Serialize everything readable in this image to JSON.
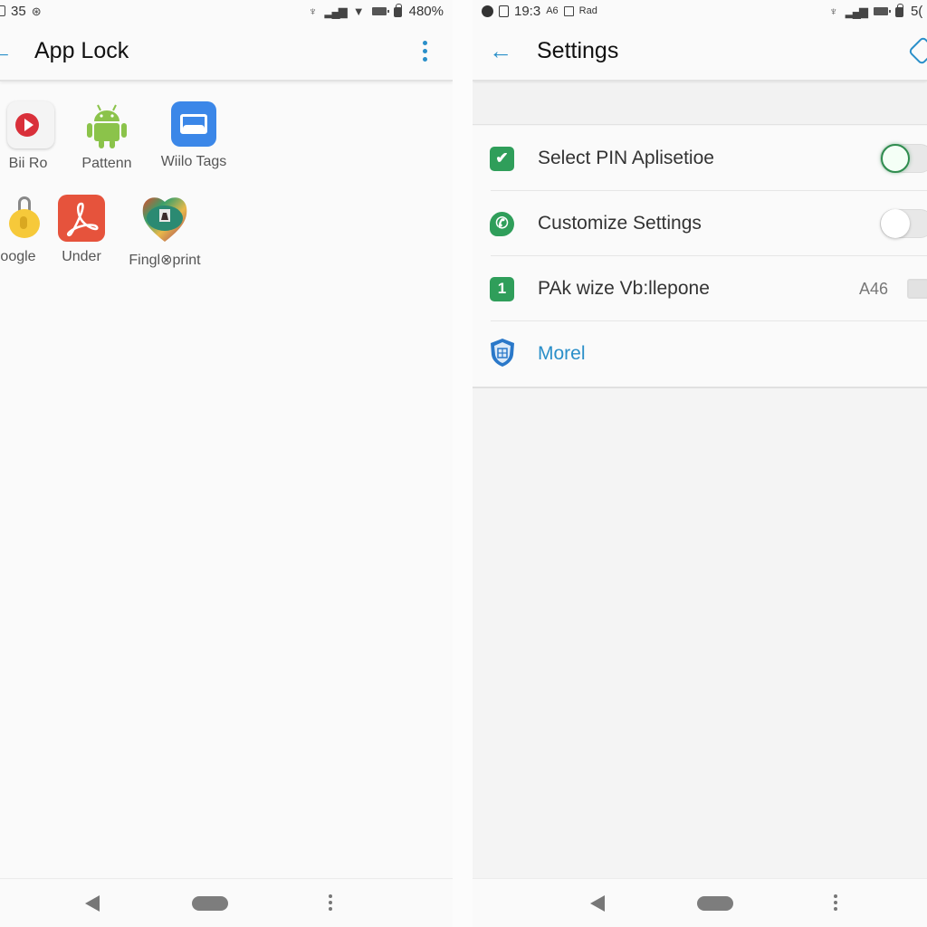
{
  "left_screen": {
    "status_bar": {
      "left_text": "35",
      "right_text": "480%",
      "icons_left": [
        "notification-icon",
        "cast-icon"
      ],
      "icons_right": [
        "hotspot-icon",
        "signal-icon",
        "wifi-icon",
        "battery-icon",
        "lock-icon"
      ]
    },
    "app_bar": {
      "title": "App Lock",
      "back_icon": "←",
      "menu_icon": "overflow-menu-icon"
    },
    "apps": [
      {
        "label": "Bii Ro",
        "icon": "play-icon"
      },
      {
        "label": "Pattenn",
        "icon": "android-icon"
      },
      {
        "label": "Wiilo Tags",
        "icon": "gallery-icon"
      },
      {
        "label": "oogle",
        "icon": "padlock-icon"
      },
      {
        "label": "Under",
        "icon": "acrobat-icon"
      },
      {
        "label": "Fingl⊗print",
        "icon": "heart-badge-icon"
      }
    ],
    "nav_bar": [
      "back",
      "home",
      "menu"
    ]
  },
  "right_screen": {
    "status_bar": {
      "left_text": "19:3",
      "left_suffix": "A6",
      "left_extra": "Rad",
      "right_text": "5("
    },
    "app_bar": {
      "title": "Settings",
      "back_icon": "←"
    },
    "settings": [
      {
        "label": "Select PIN Aplisetioe",
        "icon": "✔",
        "control": "toggle",
        "on": true
      },
      {
        "label": "Customize Settings",
        "icon": "✆",
        "control": "toggle",
        "on": false
      },
      {
        "label": "PAk wize Vb:llepone",
        "icon": "1",
        "control": "value",
        "value": "A46"
      },
      {
        "label": "Morel",
        "icon": "shield",
        "control": "none",
        "link": true
      }
    ],
    "colors": {
      "accent": "#2a8fc9",
      "green": "#2f9e5a",
      "link": "#2a8fc9"
    }
  }
}
